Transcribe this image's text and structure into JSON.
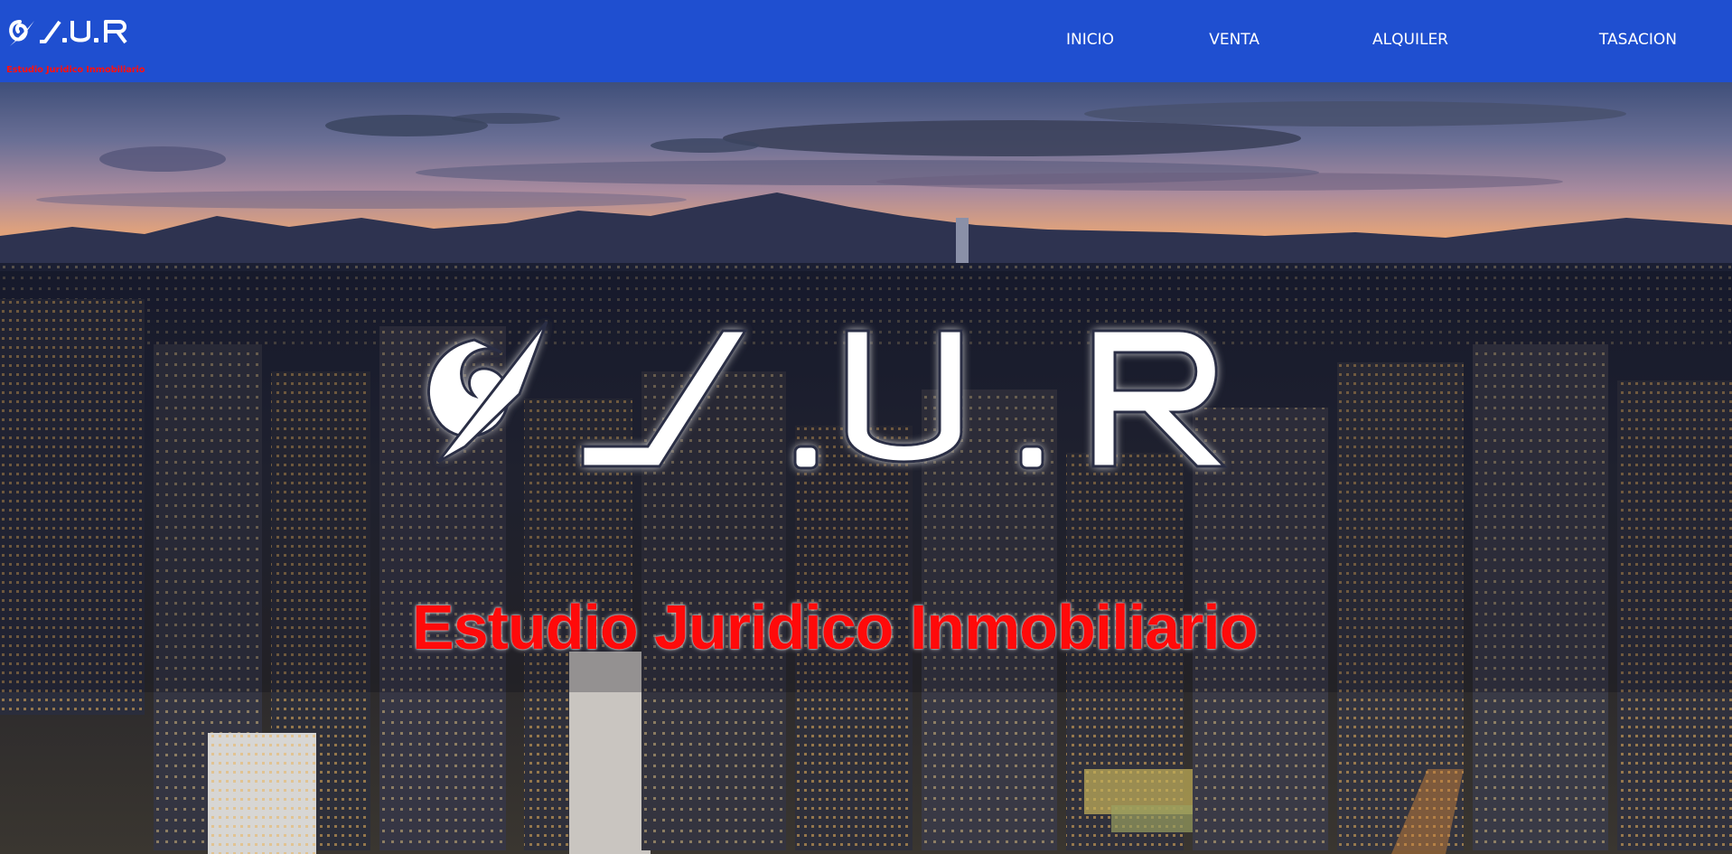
{
  "brand": {
    "logo_text": "σ/.U.R",
    "tagline": "Estudio Juridico Inmobiliario"
  },
  "nav": {
    "items": [
      {
        "label": "INICIO"
      },
      {
        "label": "VENTA"
      },
      {
        "label": "ALQUILER"
      },
      {
        "label": "TASACION"
      }
    ]
  },
  "hero": {
    "logo_text": "σ/.U.R",
    "tagline": "Estudio Juridico Inmobiliario",
    "background": "city-skyline-at-dusk"
  },
  "colors": {
    "navbar": "#1f4fd0",
    "tagline": "#ff0a0a",
    "nav_text": "#ffffff"
  }
}
